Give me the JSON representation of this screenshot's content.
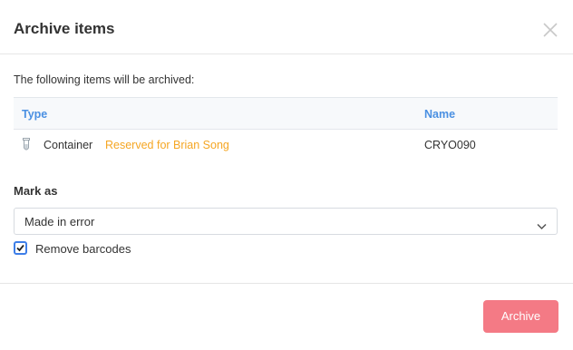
{
  "dialog": {
    "title": "Archive items",
    "close_icon": "close-icon"
  },
  "intro_text": "The following items will be archived:",
  "table": {
    "columns": [
      "Type",
      "Name"
    ],
    "rows": [
      {
        "icon": "tube-icon",
        "type": "Container",
        "status": "Reserved for Brian Song",
        "name": "CRYO090"
      }
    ]
  },
  "mark_as": {
    "label": "Mark as",
    "selected": "Made in error",
    "icon": "chevron-down-icon"
  },
  "remove_barcodes": {
    "label": "Remove barcodes",
    "checked": true
  },
  "footer": {
    "archive_label": "Archive"
  },
  "colors": {
    "header_text": "#4a90e2",
    "status_text": "#f5a623",
    "primary_button": "#f47a85",
    "checkbox_border": "#3d7ee8"
  }
}
